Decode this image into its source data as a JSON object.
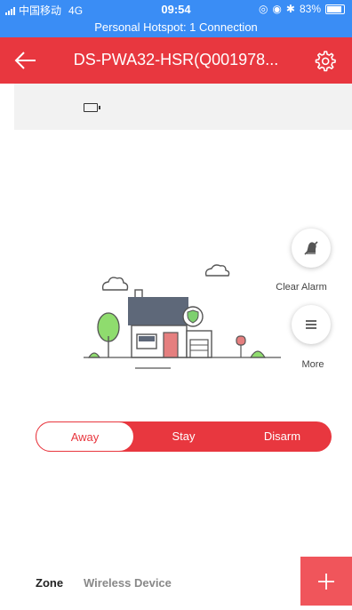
{
  "status_bar": {
    "carrier": "中国移动",
    "network": "4G",
    "time": "09:54",
    "battery": "83%",
    "hotspot": "Personal Hotspot: 1 Connection"
  },
  "header": {
    "title": "DS-PWA32-HSR(Q001978...",
    "back_icon": "back-arrow-icon",
    "settings_icon": "gear-icon"
  },
  "device_info": {
    "battery_icon": "battery-icon"
  },
  "actions": {
    "clear_alarm_label": "Clear Alarm",
    "more_label": "More"
  },
  "modes": {
    "items": [
      "Away",
      "Stay",
      "Disarm"
    ],
    "selected": "Away"
  },
  "tabs": {
    "zone": "Zone",
    "wireless_device": "Wireless Device",
    "add_icon": "plus-icon"
  },
  "colors": {
    "status_bar": "#3a8df5",
    "header": "#e8373f",
    "accent": "#e8373f",
    "add_button": "#f0555b"
  }
}
